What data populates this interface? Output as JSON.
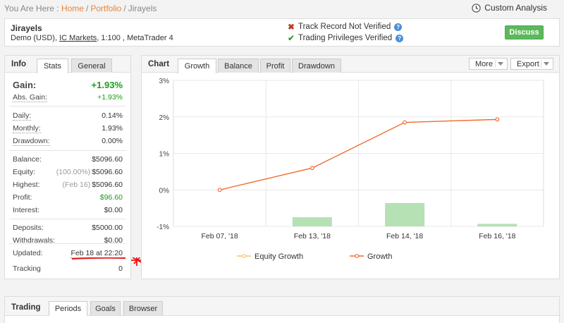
{
  "breadcrumb": {
    "prefix": "You Are Here :",
    "home": "Home",
    "portfolio": "Portfolio",
    "current": "Jirayels",
    "sep": "/"
  },
  "custom_analysis": "Custom Analysis",
  "account": {
    "name": "Jirayels",
    "detail_prefix": "Demo (USD),",
    "broker": "IC Markets",
    "detail_suffix": ", 1:100 , MetaTrader 4"
  },
  "verification": {
    "track_record": "Track Record Not Verified",
    "trading_privileges": "Trading Privileges Verified",
    "help": "?"
  },
  "discuss_label": "Discuss",
  "info": {
    "title": "Info",
    "tabs": [
      "Stats",
      "General"
    ],
    "gain_label": "Gain:",
    "gain_value": "+1.93%",
    "abs_gain_label": "Abs. Gain:",
    "abs_gain_value": "+1.93%",
    "daily_label": "Daily:",
    "daily_value": "0.14%",
    "monthly_label": "Monthly:",
    "monthly_value": "1.93%",
    "drawdown_label": "Drawdown:",
    "drawdown_value": "0.00%",
    "balance_label": "Balance:",
    "balance_value": "$5096.60",
    "equity_label": "Equity:",
    "equity_pct": "(100.00%)",
    "equity_value": "$5096.60",
    "highest_label": "Highest:",
    "highest_date": "(Feb 16)",
    "highest_value": "$5096.60",
    "profit_label": "Profit:",
    "profit_value": "$96.60",
    "interest_label": "Interest:",
    "interest_value": "$0.00",
    "deposits_label": "Deposits:",
    "deposits_value": "$5000.00",
    "withdrawals_label": "Withdrawals:",
    "withdrawals_value": "$0.00",
    "updated_label": "Updated:",
    "updated_value": "Feb 18 at 22:20",
    "tracking_label": "Tracking",
    "tracking_value": "0"
  },
  "chart_panel": {
    "title": "Chart",
    "tabs": [
      "Growth",
      "Balance",
      "Profit",
      "Drawdown"
    ],
    "more_label": "More",
    "export_label": "Export"
  },
  "chart_data": {
    "type": "line",
    "categories": [
      "Feb 07, '18",
      "Feb 13, '18",
      "Feb 14, '18",
      "Feb 16, '18"
    ],
    "yticks": [
      "3%",
      "2%",
      "1%",
      "0%",
      "-1%"
    ],
    "ylim": [
      -1,
      3
    ],
    "series": [
      {
        "name": "Equity Growth",
        "type": "bar",
        "values": [
          0,
          -0.25,
          0.64,
          0.07
        ],
        "color": "#a8dca8"
      },
      {
        "name": "Growth",
        "type": "line",
        "values": [
          0,
          0.6,
          1.85,
          1.93
        ],
        "color": "#f06a2c"
      }
    ],
    "legend_position": "bottom",
    "grid": true,
    "legend_marker_colors": {
      "equity": "#f5c26b",
      "growth": "#f06a2c"
    }
  },
  "trading": {
    "title": "Trading",
    "tabs": [
      "Periods",
      "Goals",
      "Browser"
    ]
  },
  "colors": {
    "accent": "#e8833a",
    "green": "#1a9e1a",
    "button_green": "#5cb85c",
    "annotation_red": "#e81515"
  }
}
